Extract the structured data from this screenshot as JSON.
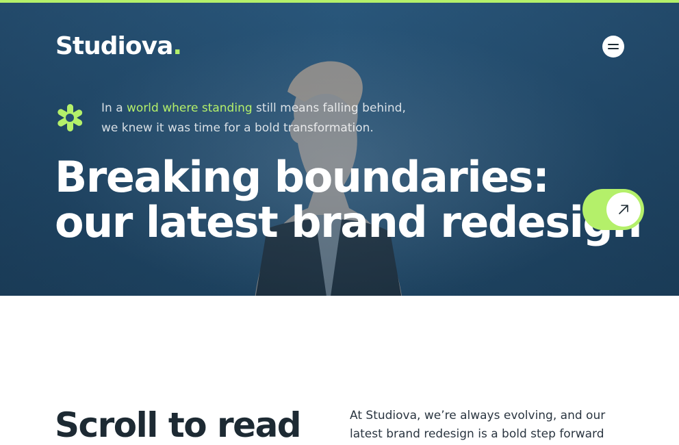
{
  "brand": {
    "name": "Studiova",
    "dot": ".",
    "accent_color": "#b4f06a"
  },
  "header": {
    "menu_icon": "menu-icon"
  },
  "hero": {
    "tagline_prefix": "In a ",
    "tagline_highlight": "world where standing",
    "tagline_suffix_line1": " still means falling behind,",
    "tagline_line2": "we knew it was time for a bold transformation.",
    "headline_line1": "Breaking boundaries:",
    "headline_line2": "our latest brand redesign",
    "cta_icon": "arrow-up-right-icon",
    "decor_icon": "asterisk-icon"
  },
  "content": {
    "section_title": "Scroll to read",
    "intro_line1": "At Studiova, we’re always evolving, and our",
    "intro_line2": "latest brand redesign is a bold step forward"
  }
}
